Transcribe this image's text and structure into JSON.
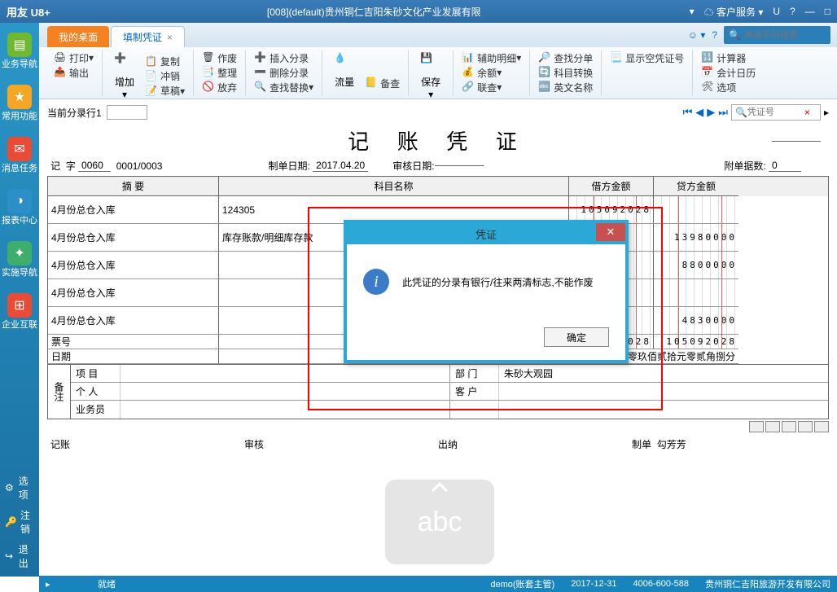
{
  "titlebar": {
    "logo": "用友 U8+",
    "title": "[008](default)贵州铜仁吉阳朱砂文化产业发展有限",
    "service": "客户服务",
    "u": "U"
  },
  "sidebar": {
    "items": [
      {
        "label": "业务导航",
        "color": "#6fb82f"
      },
      {
        "label": "常用功能",
        "color": "#f5a623"
      },
      {
        "label": "消息任务",
        "color": "#e94b35"
      },
      {
        "label": "报表中心",
        "color": "#2d8fc7"
      },
      {
        "label": "实施导航",
        "color": "#3fae6d"
      },
      {
        "label": "企业互联",
        "color": "#e94b35"
      }
    ],
    "bottom": [
      {
        "label": "选项",
        "icon": "⚙"
      },
      {
        "label": "注销",
        "icon": "🔑"
      },
      {
        "label": "退出",
        "icon": "↪"
      }
    ]
  },
  "tabs": {
    "desktop": "我的桌面",
    "active": "填制凭证",
    "search_placeholder": "单据条码搜索"
  },
  "toolbar": {
    "g1": [
      "打印",
      "输出"
    ],
    "g2_big": "增加",
    "g2": [
      "复制",
      "冲销",
      "草稿"
    ],
    "g3": [
      "作废",
      "整理",
      "放弃"
    ],
    "g4": [
      "插入分录",
      "删除分录",
      "查找替换"
    ],
    "g5_big": "流量",
    "g6": "备查",
    "g7_big": "保存",
    "g8": [
      "辅助明细",
      "余额",
      "联查"
    ],
    "g9": [
      "查找分单",
      "科目转换",
      "英文名称"
    ],
    "g10": "显示空凭证号",
    "g11": [
      "计算器",
      "会计日历",
      "选项"
    ]
  },
  "voucher": {
    "current_line": "当前分录行1",
    "title": "记 账 凭 证",
    "word_lbl": "记",
    "word_lbl2": "字",
    "word_no": "0060",
    "seq": "0001/0003",
    "date_lbl": "制单日期:",
    "date": "2017.04.20",
    "audit_lbl": "审核日期:",
    "attach_lbl": "附单据数:",
    "attach": "0",
    "nav_search": "凭证号",
    "cols": {
      "summary": "摘 要",
      "subject": "科目名称",
      "debit": "借方金额",
      "credit": "贷方金额"
    },
    "rows": [
      {
        "summary": "4月份总仓入库",
        "subject": "124305",
        "debit": "105092028",
        "credit": ""
      },
      {
        "summary": "4月份总仓入库",
        "subject": "库存账款/明细库存款",
        "debit": "",
        "credit": "13980000"
      },
      {
        "summary": "4月份总仓入库",
        "subject": "",
        "debit": "",
        "credit": "8800000"
      },
      {
        "summary": "4月份总仓入库",
        "subject": "",
        "debit": "",
        "credit": ""
      },
      {
        "summary": "4月份总仓入库",
        "subject": "",
        "debit": "",
        "credit": "4830000"
      }
    ],
    "ticket": "票号",
    "ticket_date": "日期",
    "total_lbl": "合 计",
    "total_debit": "105092028",
    "total_credit": "105092028",
    "total_text": "五万零玖佰贰拾元零贰角捌分",
    "remark_lbl": "备注",
    "remark_rows": [
      {
        "l1": "项 目",
        "l2": "部 门",
        "v2": "朱砂大观园"
      },
      {
        "l1": "个 人",
        "l2": "客 户",
        "v2": ""
      },
      {
        "l1": "业务员",
        "l2": "",
        "v2": ""
      }
    ],
    "sign": {
      "book": "记账",
      "audit": "审核",
      "cashier": "出纳",
      "maker": "制单",
      "maker_name": "勾芳芳"
    }
  },
  "dialog": {
    "title": "凭证",
    "message": "此凭证的分录有银行/往来两清标志,不能作废",
    "ok": "确定"
  },
  "ime": "abc",
  "statusbar": {
    "ready": "就绪",
    "user": "demo(账套主管)",
    "date": "2017-12-31",
    "phone": "4006-600-588",
    "company": "贵州铜仁吉阳旅游开发有限公司"
  }
}
